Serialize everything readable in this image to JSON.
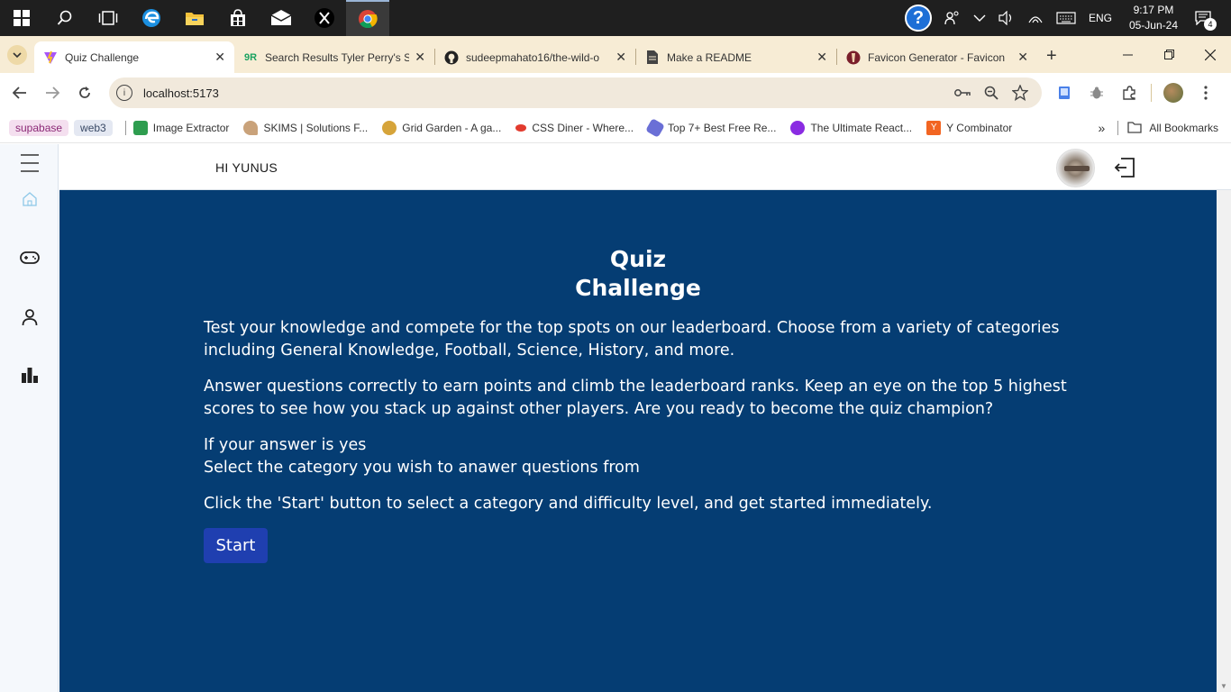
{
  "taskbar": {
    "apps": [
      {
        "name": "windows-start-icon"
      },
      {
        "name": "search-icon"
      },
      {
        "name": "task-view-icon"
      },
      {
        "name": "edge-icon"
      },
      {
        "name": "file-explorer-icon"
      },
      {
        "name": "store-icon"
      },
      {
        "name": "mail-icon"
      },
      {
        "name": "x-app-icon"
      },
      {
        "name": "chrome-icon"
      }
    ],
    "tray": {
      "language": "ENG",
      "time": "9:17 PM",
      "date": "05-Jun-24",
      "notification_count": "4"
    }
  },
  "browser": {
    "tabs": [
      {
        "title": "Quiz Challenge",
        "active": true,
        "favicon": "vite-icon"
      },
      {
        "title": "Search Results Tyler Perry's S",
        "active": false,
        "favicon": "9r-icon"
      },
      {
        "title": "sudeepmahato16/the-wild-o",
        "active": false,
        "favicon": "github-icon"
      },
      {
        "title": "Make a README",
        "active": false,
        "favicon": "document-icon"
      },
      {
        "title": "Favicon Generator - Favicon",
        "active": false,
        "favicon": "favicon-generator-icon"
      }
    ],
    "url": "localhost:5173",
    "bookmarks": [
      {
        "label": "supabase",
        "style": "pink-chip"
      },
      {
        "label": "web3",
        "style": "blue-chip"
      },
      {
        "label": "Image Extractor",
        "color": "#2e9d4f"
      },
      {
        "label": "SKIMS | Solutions F...",
        "color": "#c9a27a"
      },
      {
        "label": "Grid Garden - A ga...",
        "color": "#d6a43a"
      },
      {
        "label": "CSS Diner - Where...",
        "color": "#e23b2e"
      },
      {
        "label": "Top 7+ Best Free Re...",
        "color": "#6a6fd6"
      },
      {
        "label": "The Ultimate React...",
        "color": "#8a2be2"
      },
      {
        "label": "Y Combinator",
        "color": "#f26522"
      }
    ],
    "all_bookmarks": "All Bookmarks"
  },
  "app": {
    "greeting": "HI YUNUS",
    "sidebar": [
      {
        "name": "menu-icon"
      },
      {
        "name": "home-icon"
      },
      {
        "name": "gamepad-icon"
      },
      {
        "name": "user-icon"
      },
      {
        "name": "leaderboard-icon"
      }
    ],
    "hero": {
      "title_line1": "Quiz",
      "title_line2": "Challenge",
      "p1": "Test your knowledge and compete for the top spots on our leaderboard. Choose from a variety of categories including General Knowledge, Football, Science, History, and more.",
      "p2": "Answer questions correctly to earn points and climb the leaderboard ranks. Keep an eye on the top 5 highest scores to see how you stack up against other players. Are you ready to become the quiz champion?",
      "p3_line1": "If your answer is yes",
      "p3_line2": "Select the category you wish to anawer questions from",
      "p4": "Click the 'Start' button to select a category and difficulty level, and get started immediately.",
      "start_label": "Start"
    },
    "colors": {
      "hero_bg": "#053d73",
      "start_btn": "#1f3fb0",
      "sidebar_bg": "#f5f8fc"
    }
  }
}
